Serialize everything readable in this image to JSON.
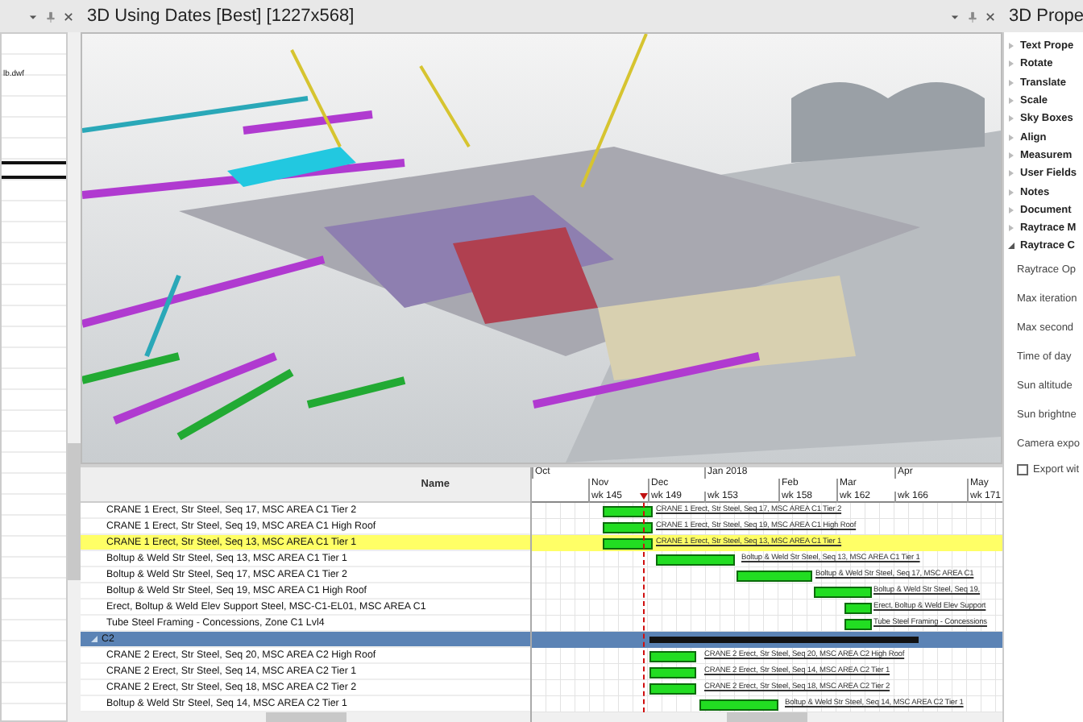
{
  "left_panel": {
    "items": [
      {
        "label": "lb.dwf"
      }
    ]
  },
  "viewport": {
    "title": "3D Using Dates [Best] [1227x568]"
  },
  "task_list": {
    "column": "Name",
    "rows": [
      {
        "kind": "task",
        "name": "CRANE 1 Erect, Str Steel, Seq 17,  MSC AREA C1 Tier 2",
        "bar_label": "CRANE 1 Erect, Str Steel, Seq 17,  MSC AREA C1 Tier 2",
        "selected": false
      },
      {
        "kind": "task",
        "name": "CRANE 1 Erect, Str Steel, Seq 19,  MSC AREA C1 High Roof",
        "bar_label": "CRANE 1 Erect, Str Steel, Seq 19,  MSC AREA C1 High Roof",
        "selected": false
      },
      {
        "kind": "task",
        "name": "CRANE 1 Erect, Str Steel, Seq 13,  MSC AREA C1 Tier 1",
        "bar_label": "CRANE 1 Erect, Str Steel, Seq 13,  MSC AREA C1 Tier 1",
        "selected": true
      },
      {
        "kind": "task",
        "name": "Boltup & Weld Str Steel, Seq 13, MSC AREA C1 Tier 1",
        "bar_label": "Boltup & Weld Str Steel, Seq 13, MSC AREA C1 Tier 1",
        "selected": false
      },
      {
        "kind": "task",
        "name": "Boltup & Weld Str Steel, Seq 17, MSC AREA C1 Tier 2",
        "bar_label": "Boltup & Weld Str Steel, Seq 17, MSC AREA C1",
        "selected": false
      },
      {
        "kind": "task",
        "name": "Boltup & Weld Str Steel, Seq 19, MSC AREA C1 High Roof",
        "bar_label": "Boltup & Weld Str Steel, Seq 19,",
        "selected": false
      },
      {
        "kind": "task",
        "name": "Erect, Boltup & Weld Elev Support Steel, MSC-C1-EL01, MSC AREA C1",
        "bar_label": "Erect, Boltup & Weld Elev Support",
        "selected": false
      },
      {
        "kind": "task",
        "name": "Tube Steel Framing - Concessions, Zone C1 Lvl4",
        "bar_label": "Tube Steel Framing - Concessions",
        "selected": false
      },
      {
        "kind": "group",
        "name": "C2",
        "expanded": true,
        "selected": false
      },
      {
        "kind": "task",
        "name": "CRANE 2 Erect, Str Steel, Seq 20,  MSC AREA C2 High Roof",
        "bar_label": "CRANE 2 Erect, Str Steel, Seq 20,  MSC AREA C2 High Roof",
        "selected": false
      },
      {
        "kind": "task",
        "name": "CRANE 2 Erect, Str Steel, Seq 14,  MSC AREA C2 Tier 1",
        "bar_label": "CRANE 2 Erect, Str Steel, Seq 14,  MSC AREA C2 Tier 1",
        "selected": false
      },
      {
        "kind": "task",
        "name": "CRANE 2 Erect, Str Steel, Seq 18,  MSC AREA C2 Tier 2",
        "bar_label": "CRANE 2 Erect, Str Steel, Seq 18,  MSC AREA C2 Tier 2",
        "selected": false
      },
      {
        "kind": "task",
        "name": "Boltup & Weld Str Steel, Seq 14, MSC AREA C2 Tier 1",
        "bar_label": "Boltup & Weld Str Steel, Seq 14, MSC AREA C2 Tier 1",
        "selected": false
      }
    ]
  },
  "gantt": {
    "quarters": [
      "Oct",
      "Jan 2018",
      "Apr"
    ],
    "months": [
      "Nov",
      "Dec",
      "Feb",
      "Mar",
      "May"
    ],
    "weeks": [
      "wk 145",
      "wk 149",
      "wk 153",
      "wk 158",
      "wk 162",
      "wk 166",
      "wk 171"
    ]
  },
  "properties": {
    "title": "3D Prope",
    "sections": [
      {
        "label": "Text Prope",
        "expanded": false
      },
      {
        "label": "Rotate",
        "expanded": false
      },
      {
        "label": "Translate",
        "expanded": false
      },
      {
        "label": "Scale",
        "expanded": false
      },
      {
        "label": "Sky Boxes",
        "expanded": false
      },
      {
        "label": "Align",
        "expanded": false
      },
      {
        "label": "Measurem",
        "expanded": false
      },
      {
        "label": "User Fields",
        "expanded": false
      },
      {
        "label": "Notes",
        "expanded": false
      },
      {
        "label": "Document",
        "expanded": false
      },
      {
        "label": "Raytrace M",
        "expanded": false
      },
      {
        "label": "Raytrace C",
        "expanded": true
      }
    ],
    "fields": [
      "Raytrace Op",
      "Max iteration",
      "Max second",
      "Time of day",
      "Sun altitude",
      "Sun brightne",
      "Camera expo"
    ],
    "checkbox": {
      "label": "Export wit",
      "checked": false
    }
  }
}
